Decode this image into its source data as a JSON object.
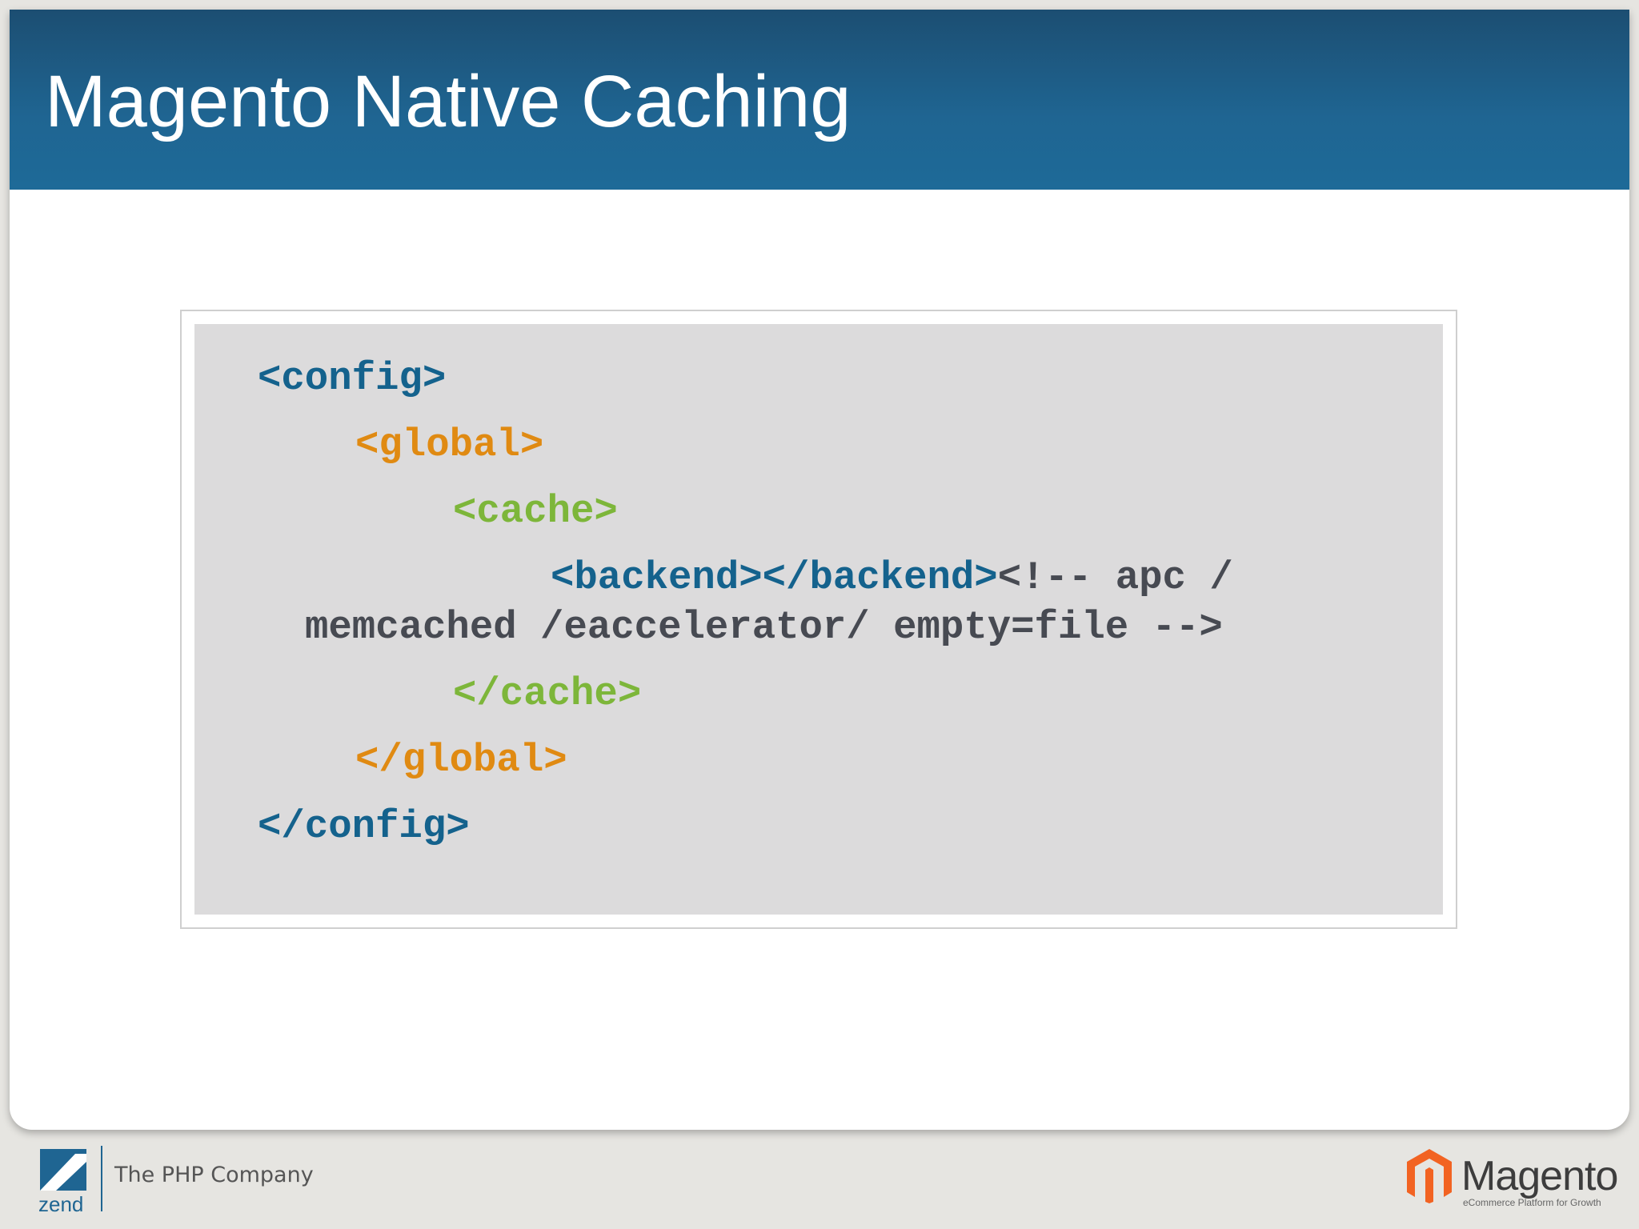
{
  "slide": {
    "title": "Magento Native Caching"
  },
  "code": {
    "lines": [
      {
        "text": "<config>",
        "color": "#14628d"
      },
      {
        "text": "<global>",
        "color": "#e08a12"
      },
      {
        "text": "<cache>",
        "color": "#7db63a"
      },
      {
        "tag_text": "<backend></backend>",
        "comment_text": "<!-- apc /",
        "tag_color": "#14628d",
        "comment_color": "#474a52"
      },
      {
        "text": "memcached /eaccelerator/ empty=file -->",
        "color": "#474a52"
      },
      {
        "text": "</cache>",
        "color": "#7db63a"
      },
      {
        "text": "</global>",
        "color": "#e08a12"
      },
      {
        "text": "</config>",
        "color": "#14628d"
      }
    ]
  },
  "footer": {
    "zend_logo_text": "zend",
    "tagline": "The PHP Company",
    "magento_wordmark": "Magento",
    "magento_tagline": "eCommerce Platform for Growth",
    "zend_icon": "zend-logo-icon",
    "magento_icon": "magento-logo-icon",
    "colors": {
      "title_bar": "#1f6592",
      "zend_blue": "#1f6592",
      "magento_orange": "#f26322"
    }
  }
}
